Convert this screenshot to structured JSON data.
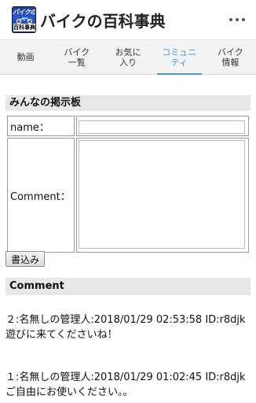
{
  "app": {
    "title": "バイクの百科事典",
    "icon_top_text": "バイクの",
    "icon_bottom_text": "百科事典",
    "icon": "app-logo-icon",
    "menu_icon": "more-vert-icon"
  },
  "tabs": [
    {
      "label": "動画",
      "active": false
    },
    {
      "label": "バイク\n一覧",
      "active": false
    },
    {
      "label": "お気に\n入り",
      "active": false
    },
    {
      "label": "コミュニ\nティ",
      "active": true
    },
    {
      "label": "バイク\n情報",
      "active": false
    }
  ],
  "board": {
    "title": "みんなの掲示板",
    "name_label": "name：",
    "name_value": "",
    "comment_label": "Comment：",
    "comment_value": "",
    "submit_label": "書込み"
  },
  "comments": {
    "heading": "Comment",
    "posts": [
      {
        "meta": "２:名無しの管理人:2018/01/29 02:53:58 ID:r8djk",
        "body": "遊びに来てくださいね！"
      },
      {
        "meta": "１:名無しの管理人:2018/01/29 01:02:45 ID:r8djk",
        "body": "ご自由にお使いください。。"
      }
    ]
  },
  "colors": {
    "accent": "#3f9be0",
    "section_bg": "#e8e8e8",
    "tab_bg": "#f3f3f3"
  }
}
